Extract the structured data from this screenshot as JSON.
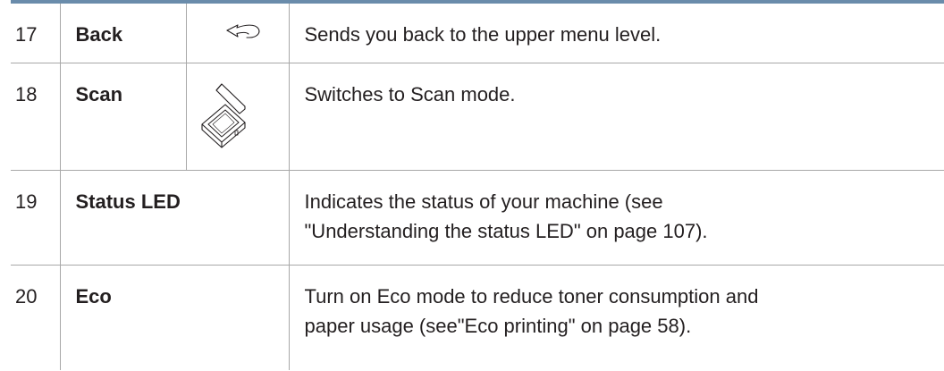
{
  "rows": [
    {
      "number": "17",
      "name": "Back",
      "icon": "back-arrow-icon",
      "description": [
        "Sends you back to the upper menu level."
      ]
    },
    {
      "number": "18",
      "name": "Scan",
      "icon": "scanner-icon",
      "description": [
        "Switches to Scan mode."
      ]
    },
    {
      "number": "19",
      "name": "Status LED",
      "description": [
        "Indicates the status of your machine (see",
        "\"Understanding the status LED\" on page 107)."
      ]
    },
    {
      "number": "20",
      "name": "Eco",
      "description": [
        "Turn on Eco mode to reduce toner consumption and",
        "paper usage (see\"Eco printing\" on page 58)."
      ]
    }
  ],
  "colors": {
    "top_rule": "#6a8cab",
    "grid_lines": "#a8a8a8",
    "text": "#231f20"
  }
}
